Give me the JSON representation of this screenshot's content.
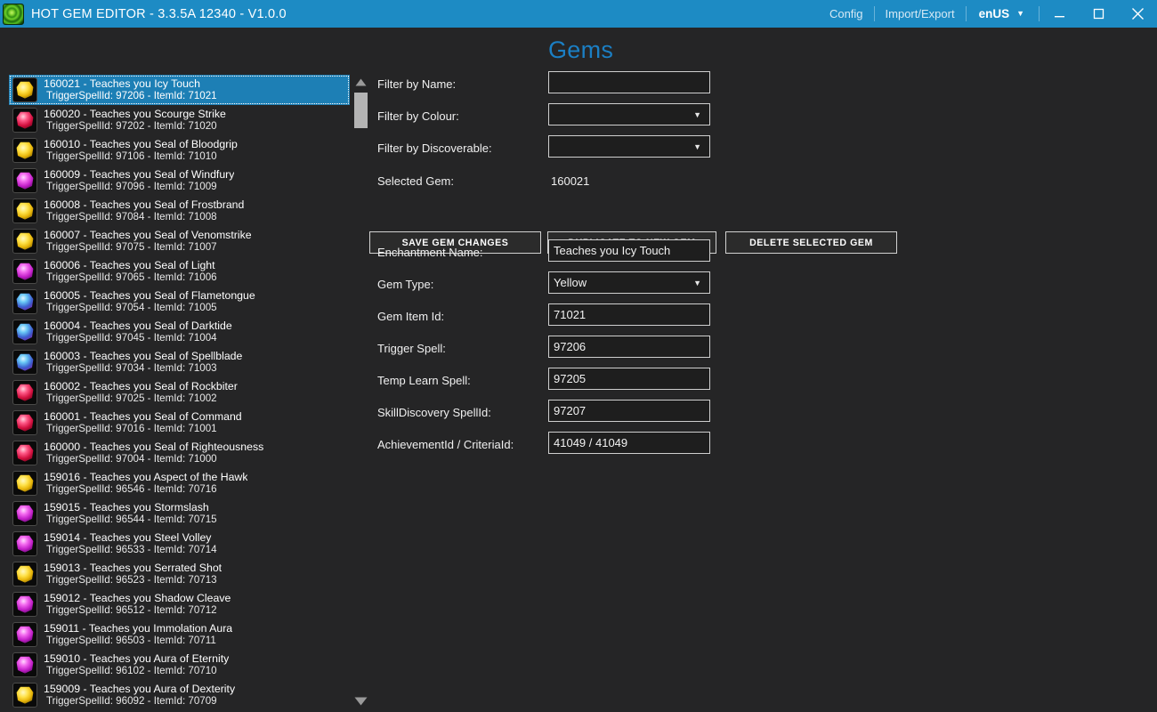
{
  "titlebar": {
    "app_icon": "swirl-green-icon",
    "title": "HOT GEM EDITOR - 3.3.5A 12340 - V1.0.0",
    "config_label": "Config",
    "import_export_label": "Import/Export",
    "language": "enUS",
    "language_caret": "▼",
    "bg_color": "#1d8bc4",
    "minimize_label": "Minimize",
    "maximize_label": "Maximize",
    "close_label": "Close"
  },
  "page": {
    "title": "Gems",
    "title_color": "#1b7fc4",
    "background": "#252526"
  },
  "form": {
    "filter_name_label": "Filter by Name:",
    "filter_name_value": "",
    "filter_colour_label": "Filter by Colour:",
    "filter_colour_value": "",
    "filter_discoverable_label": "Filter by Discoverable:",
    "filter_discoverable_value": "",
    "selected_gem_label": "Selected Gem:",
    "selected_gem_value": "160021",
    "enchantment_name_label": "Enchantment Name:",
    "enchantment_name_value": "Teaches you Icy Touch",
    "gem_type_label": "Gem Type:",
    "gem_type_value": "Yellow",
    "gem_item_id_label": "Gem Item Id:",
    "gem_item_id_value": "71021",
    "trigger_spell_label": "Trigger Spell:",
    "trigger_spell_value": "97206",
    "temp_learn_spell_label": "Temp Learn Spell:",
    "temp_learn_spell_value": "97205",
    "skilldiscovery_spellid_label": "SkillDiscovery SpellId:",
    "skilldiscovery_spellid_value": "97207",
    "achievement_criteria_label": "AchievementId / CriteriaId:",
    "achievement_criteria_value": "41049 / 41049",
    "caret": "▼"
  },
  "buttons": {
    "save": "SAVE GEM CHANGES",
    "duplicate": "DUPLICATE TO NEW GEM",
    "delete": "DELETE SELECTED GEM"
  },
  "scrollbar": {
    "up_arrow": "triangle-up-icon",
    "down_arrow": "triangle-down-icon",
    "thumb": "scroll-thumb"
  },
  "gem_list": {
    "selected_index": 0,
    "items": [
      {
        "line1": "160021 - Teaches you Icy Touch",
        "line2": "TriggerSpellId: 97206 - ItemId: 71021",
        "colour": "yellow"
      },
      {
        "line1": "160020 - Teaches you Scourge Strike",
        "line2": "TriggerSpellId: 97202 - ItemId: 71020",
        "colour": "red"
      },
      {
        "line1": "160010 - Teaches you Seal of Bloodgrip",
        "line2": "TriggerSpellId: 97106 - ItemId: 71010",
        "colour": "yellow"
      },
      {
        "line1": "160009 - Teaches you Seal of Windfury",
        "line2": "TriggerSpellId: 97096 - ItemId: 71009",
        "colour": "purple"
      },
      {
        "line1": "160008 - Teaches you Seal of Frostbrand",
        "line2": "TriggerSpellId: 97084 - ItemId: 71008",
        "colour": "yellow"
      },
      {
        "line1": "160007 - Teaches you Seal of Venomstrike",
        "line2": "TriggerSpellId: 97075 - ItemId: 71007",
        "colour": "yellow"
      },
      {
        "line1": "160006 - Teaches you Seal of Light",
        "line2": "TriggerSpellId: 97065 - ItemId: 71006",
        "colour": "purple"
      },
      {
        "line1": "160005 - Teaches you Seal of Flametongue",
        "line2": "TriggerSpellId: 97054 - ItemId: 71005",
        "colour": "blue"
      },
      {
        "line1": "160004 - Teaches you Seal of Darktide",
        "line2": "TriggerSpellId: 97045 - ItemId: 71004",
        "colour": "blue"
      },
      {
        "line1": "160003 - Teaches you Seal of Spellblade",
        "line2": "TriggerSpellId: 97034 - ItemId: 71003",
        "colour": "blue"
      },
      {
        "line1": "160002 - Teaches you Seal of Rockbiter",
        "line2": "TriggerSpellId: 97025 - ItemId: 71002",
        "colour": "red"
      },
      {
        "line1": "160001 - Teaches you Seal of Command",
        "line2": "TriggerSpellId: 97016 - ItemId: 71001",
        "colour": "red"
      },
      {
        "line1": "160000 - Teaches you Seal of Righteousness",
        "line2": "TriggerSpellId: 97004 - ItemId: 71000",
        "colour": "red"
      },
      {
        "line1": "159016 - Teaches you Aspect of the Hawk",
        "line2": "TriggerSpellId: 96546 - ItemId: 70716",
        "colour": "yellow"
      },
      {
        "line1": "159015 - Teaches you Stormslash",
        "line2": "TriggerSpellId: 96544 - ItemId: 70715",
        "colour": "purple"
      },
      {
        "line1": "159014 - Teaches you Steel Volley",
        "line2": "TriggerSpellId: 96533 - ItemId: 70714",
        "colour": "purple"
      },
      {
        "line1": "159013 - Teaches you Serrated Shot",
        "line2": "TriggerSpellId: 96523 - ItemId: 70713",
        "colour": "yellow"
      },
      {
        "line1": "159012 - Teaches you Shadow Cleave",
        "line2": "TriggerSpellId: 96512 - ItemId: 70712",
        "colour": "purple"
      },
      {
        "line1": "159011 - Teaches you Immolation Aura",
        "line2": "TriggerSpellId: 96503 - ItemId: 70711",
        "colour": "purple"
      },
      {
        "line1": "159010 - Teaches you Aura of Eternity",
        "line2": "TriggerSpellId: 96102 - ItemId: 70710",
        "colour": "purple"
      },
      {
        "line1": "159009 - Teaches you Aura of Dexterity",
        "line2": "TriggerSpellId: 96092 - ItemId: 70709",
        "colour": "yellow"
      }
    ]
  }
}
